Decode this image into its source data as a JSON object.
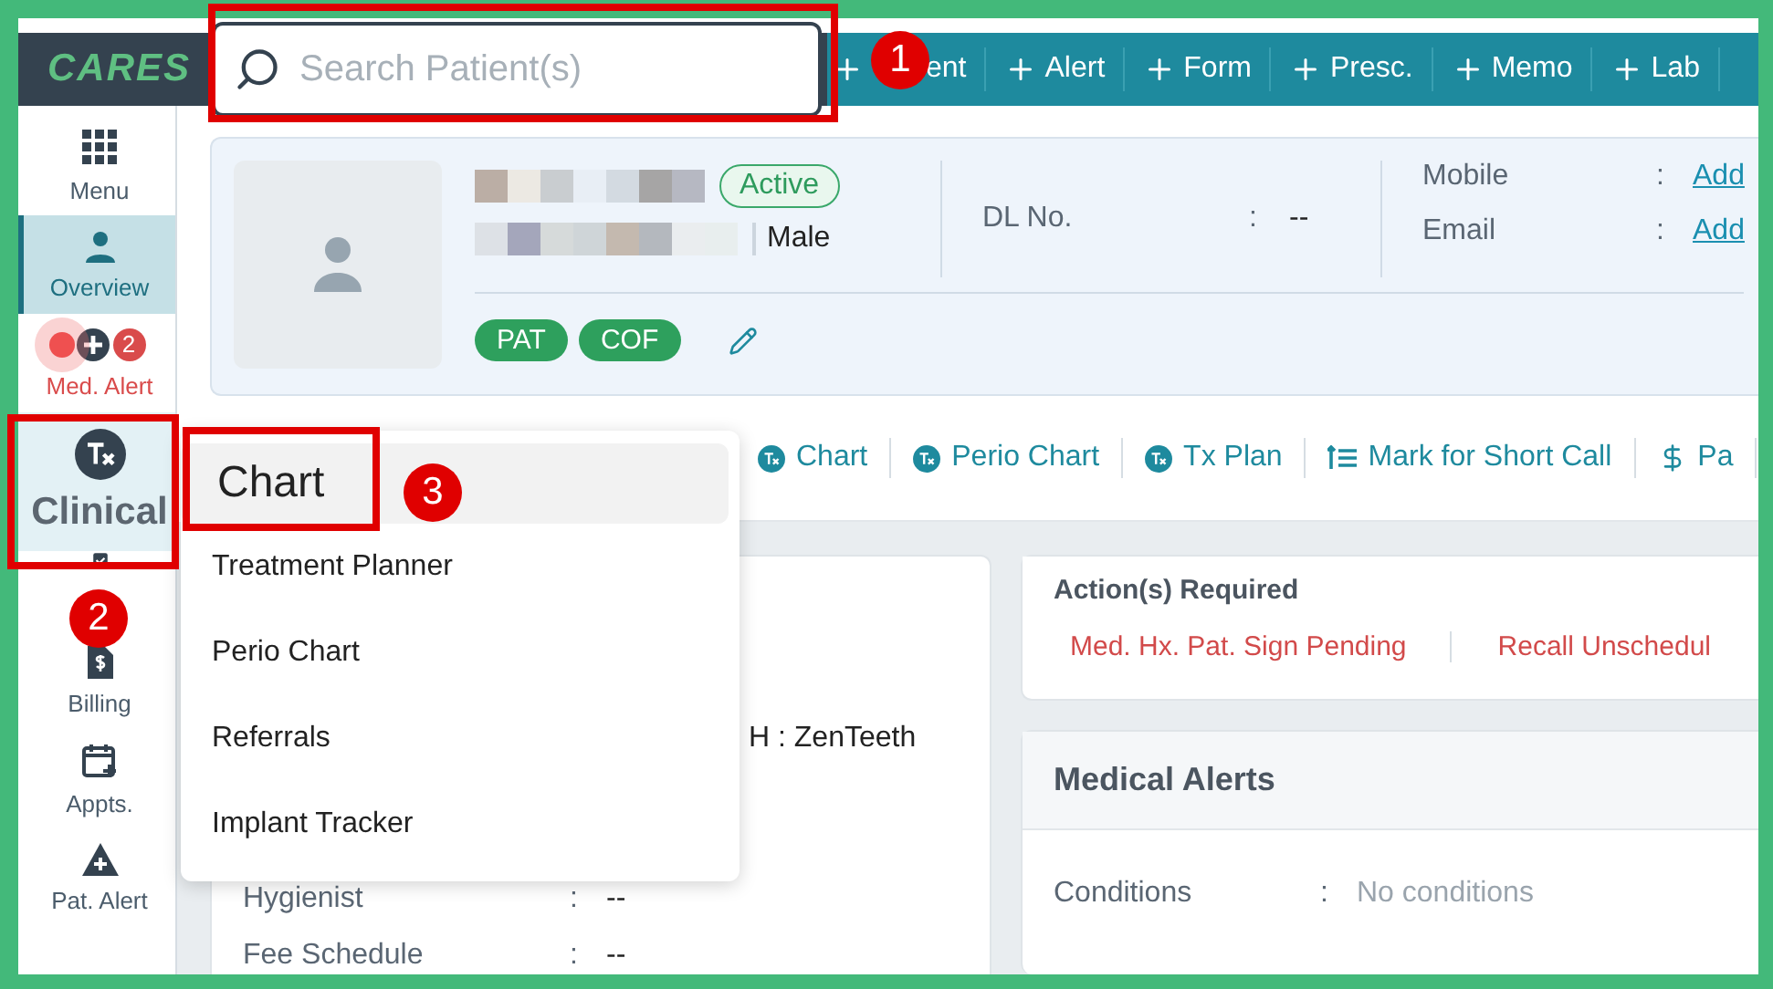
{
  "logo": "CARES",
  "search": {
    "placeholder": "Search Patient(s)"
  },
  "quick_actions": [
    {
      "label": "ent"
    },
    {
      "label": "Alert"
    },
    {
      "label": "Form"
    },
    {
      "label": "Presc."
    },
    {
      "label": "Memo"
    },
    {
      "label": "Lab"
    }
  ],
  "sidebar": {
    "items": [
      {
        "label": "Menu",
        "kind": "grid",
        "selected": false,
        "hovered": false
      },
      {
        "label": "Overview",
        "kind": "person",
        "selected": true,
        "hovered": false
      },
      {
        "label": "Med. Alert",
        "kind": "alert",
        "badge": "2",
        "selected": false,
        "hovered": false
      },
      {
        "label": "Clinical",
        "kind": "tx",
        "selected": false,
        "hovered": true
      },
      {
        "kind": "clipboard",
        "selected": false,
        "hovered": false
      },
      {
        "label": "Billing",
        "kind": "bill",
        "selected": false,
        "hovered": false
      },
      {
        "label": "Appts.",
        "kind": "calendar",
        "selected": false,
        "hovered": false
      },
      {
        "label": "Pat. Alert",
        "kind": "warning",
        "selected": false,
        "hovered": false
      }
    ]
  },
  "patient": {
    "status": "Active",
    "gender": "Male",
    "dl": {
      "label": "DL No.",
      "sep": ":",
      "value": "--"
    },
    "contacts": [
      {
        "label": "Mobile",
        "sep": ":",
        "action": "Add"
      },
      {
        "label": "Email",
        "sep": ":",
        "action": "Add"
      }
    ],
    "tags": [
      "PAT",
      "COF"
    ]
  },
  "tabs": [
    {
      "label": "Chart",
      "kind": "tx"
    },
    {
      "label": "Perio Chart",
      "kind": "tx"
    },
    {
      "label": "Tx Plan",
      "kind": "tx"
    },
    {
      "label": "Mark for Short Call",
      "kind": "list"
    },
    {
      "label": "Pa",
      "kind": "dollar"
    }
  ],
  "details": {
    "rows": [
      {
        "text": "H : ZenTeeth"
      },
      {
        "label": "Hygienist",
        "sep": ":",
        "value": "--"
      },
      {
        "label": "Fee Schedule",
        "sep": ":",
        "value": "--"
      }
    ]
  },
  "actions_required": {
    "title": "Action(s) Required",
    "items": [
      "Med. Hx. Pat. Sign Pending",
      "Recall Unschedul"
    ]
  },
  "medical_alerts": {
    "title": "Medical Alerts",
    "rows": [
      {
        "label": "Conditions",
        "sep": ":",
        "value": "No conditions"
      }
    ]
  },
  "dropdown": {
    "items": [
      {
        "label": "Chart",
        "selected": true
      },
      {
        "label": "Treatment Planner",
        "selected": false
      },
      {
        "label": "Perio Chart",
        "selected": false
      },
      {
        "label": "Referrals",
        "selected": false
      },
      {
        "label": "Implant Tracker",
        "selected": false
      }
    ]
  },
  "callouts": [
    {
      "number": "1"
    },
    {
      "number": "2"
    },
    {
      "number": "3"
    }
  ]
}
